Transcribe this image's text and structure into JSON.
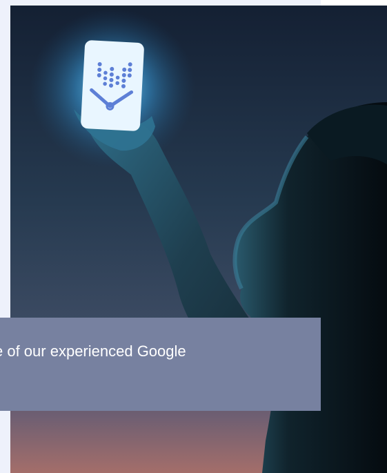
{
  "hero": {
    "image_icon": "phone-with-analytics-logo",
    "colors": {
      "sky_top": "#141e2e",
      "sky_mid": "#2a3d53",
      "sky_bottom": "#a46e6a",
      "glow": "#5ec8ff",
      "logo": "#5d7fd6",
      "panel": "#eef1fb",
      "caption_bg": "#7781a0"
    }
  },
  "caption": {
    "text": "e of our experienced Google"
  }
}
